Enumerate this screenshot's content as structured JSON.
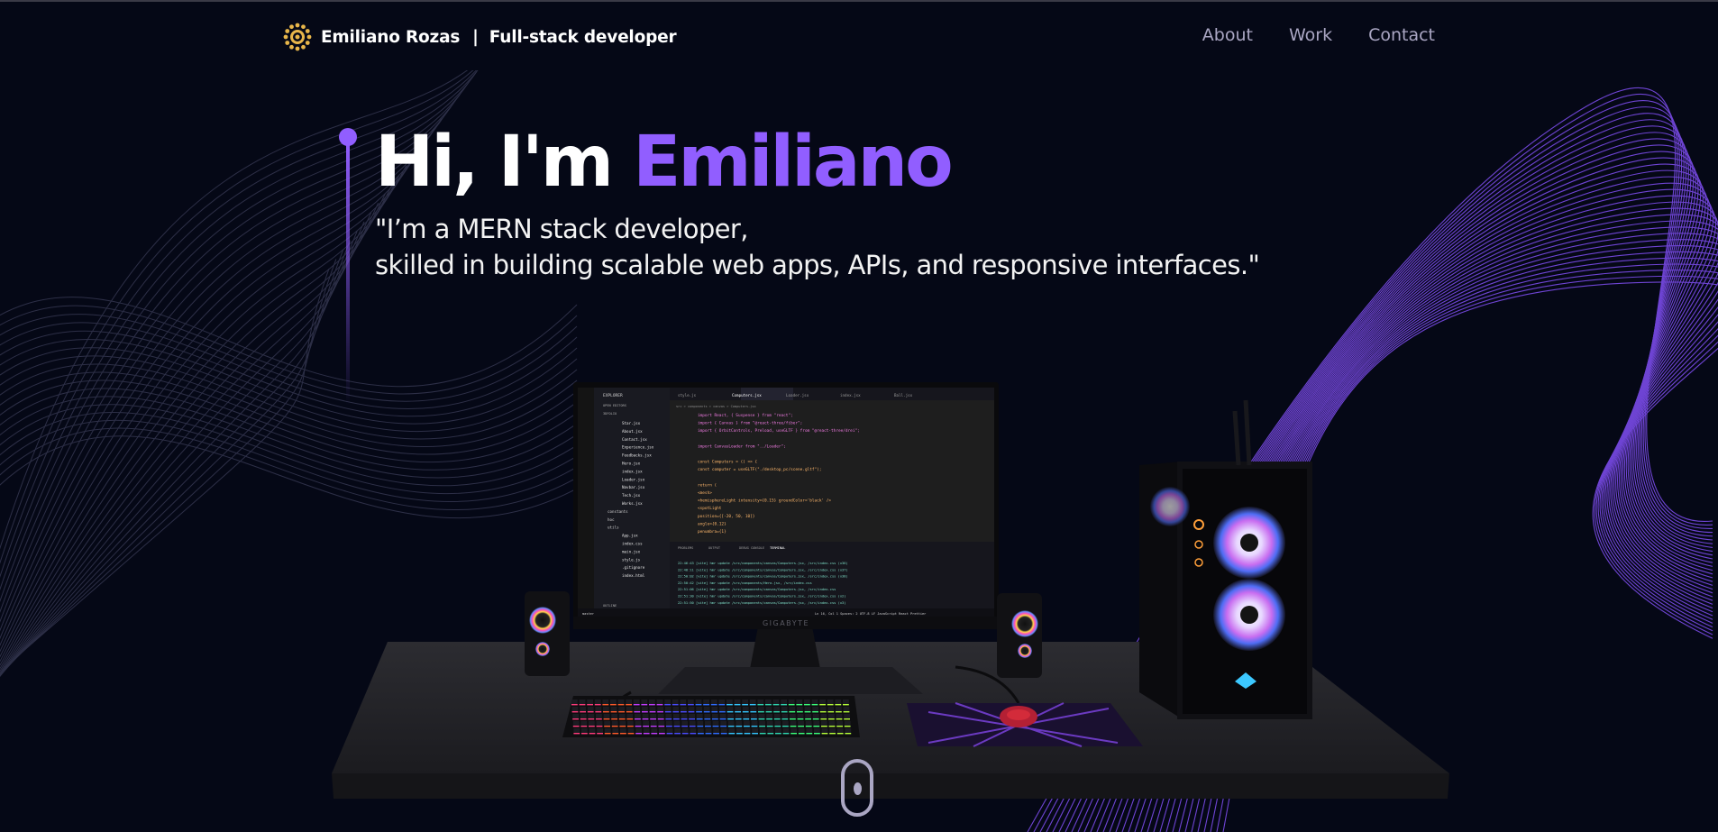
{
  "brand": {
    "name": "Emiliano Rozas",
    "separator": "|",
    "role": "Full-stack developer",
    "logo_icon": "gear-sun-logo-icon"
  },
  "nav": {
    "links": [
      "About",
      "Work",
      "Contact"
    ]
  },
  "hero": {
    "greeting": "Hi, I'm",
    "name": "Emiliano",
    "line1": "\"I’m a MERN stack developer,",
    "line2": "skilled in building scalable web apps, APIs, and responsive interfaces.\""
  },
  "scene": {
    "monitor_brand": "GIGABYTE",
    "editor": {
      "explorer_title": "EXPLORER",
      "section_open": "OPEN EDITORS",
      "section_project": "3DFOLIO",
      "files": [
        "Star.jsx",
        "About.jsx",
        "Contact.jsx",
        "Experience.jsx",
        "Feedbacks.jsx",
        "Hero.jsx",
        "index.jsx",
        "Loader.jsx",
        "Navbar.jsx",
        "Tech.jsx",
        "Works.jsx",
        "constants",
        "hoc",
        "utils",
        "App.jsx",
        "index.css",
        "main.jsx",
        "style.js",
        ".gitignore",
        "index.html"
      ],
      "outline": "OUTLINE",
      "tabs": [
        "style.js",
        "Computers.jsx",
        "Loader.jsx",
        "index.jsx",
        "Ball.jsx"
      ],
      "breadcrumb": "src > components > canvas > Computers.jsx",
      "code": [
        "import React, { Suspense } from \"react\";",
        "import { Canvas } from \"@react-three/fiber\";",
        "import { OrbitControls, Preload, useGLTF } from \"@react-three/drei\";",
        "",
        "import CanvasLoader from \"../Loader\";",
        "",
        "const Computers = () => {",
        "  const computer = useGLTF(\"./desktop_pc/scene.gltf\");",
        "",
        "  return (",
        "    <mesh>",
        "      <hemisphereLight intensity={0.15} groundColor='black' />",
        "      <spotLight",
        "        position={[-20, 50, 10]}",
        "        angle={0.12}",
        "        penumbra={1}"
      ],
      "panel_tabs": [
        "PROBLEMS",
        "OUTPUT",
        "DEBUG CONSOLE",
        "TERMINAL"
      ],
      "terminal": [
        "22:46:43 [vite] hmr update /src/components/canvas/Computers.jsx, /src/index.css (x36)",
        "22:48:11 [vite] hmr update /src/components/canvas/Computers.jsx, /src/index.css (x37)",
        "22:50:02 [vite] hmr update /src/components/canvas/Computers.jsx, /src/index.css (x38)",
        "22:50:42 [vite] hmr update /src/components/Hero.jsx, /src/index.css",
        "22:51:06 [vite] hmr update /src/components/canvas/Computers.jsx, /src/index.css",
        "22:51:30 [vite] hmr update /src/components/canvas/Computers.jsx, /src/index.css (x2)",
        "22:51:50 [vite] hmr update /src/components/canvas/Computers.jsx, /src/index.css (x3)"
      ],
      "status_left": "master",
      "status_right": "Ln 16, Col 1   Spaces: 2   UTF-8   LF   JavaScript React   Prettier"
    }
  },
  "scroll_indicator": {
    "icon": "mouse-scroll-icon"
  },
  "colors": {
    "background": "#050816",
    "accent": "#915eff",
    "nav_link": "#aaa6c3",
    "text": "#ffffff"
  }
}
